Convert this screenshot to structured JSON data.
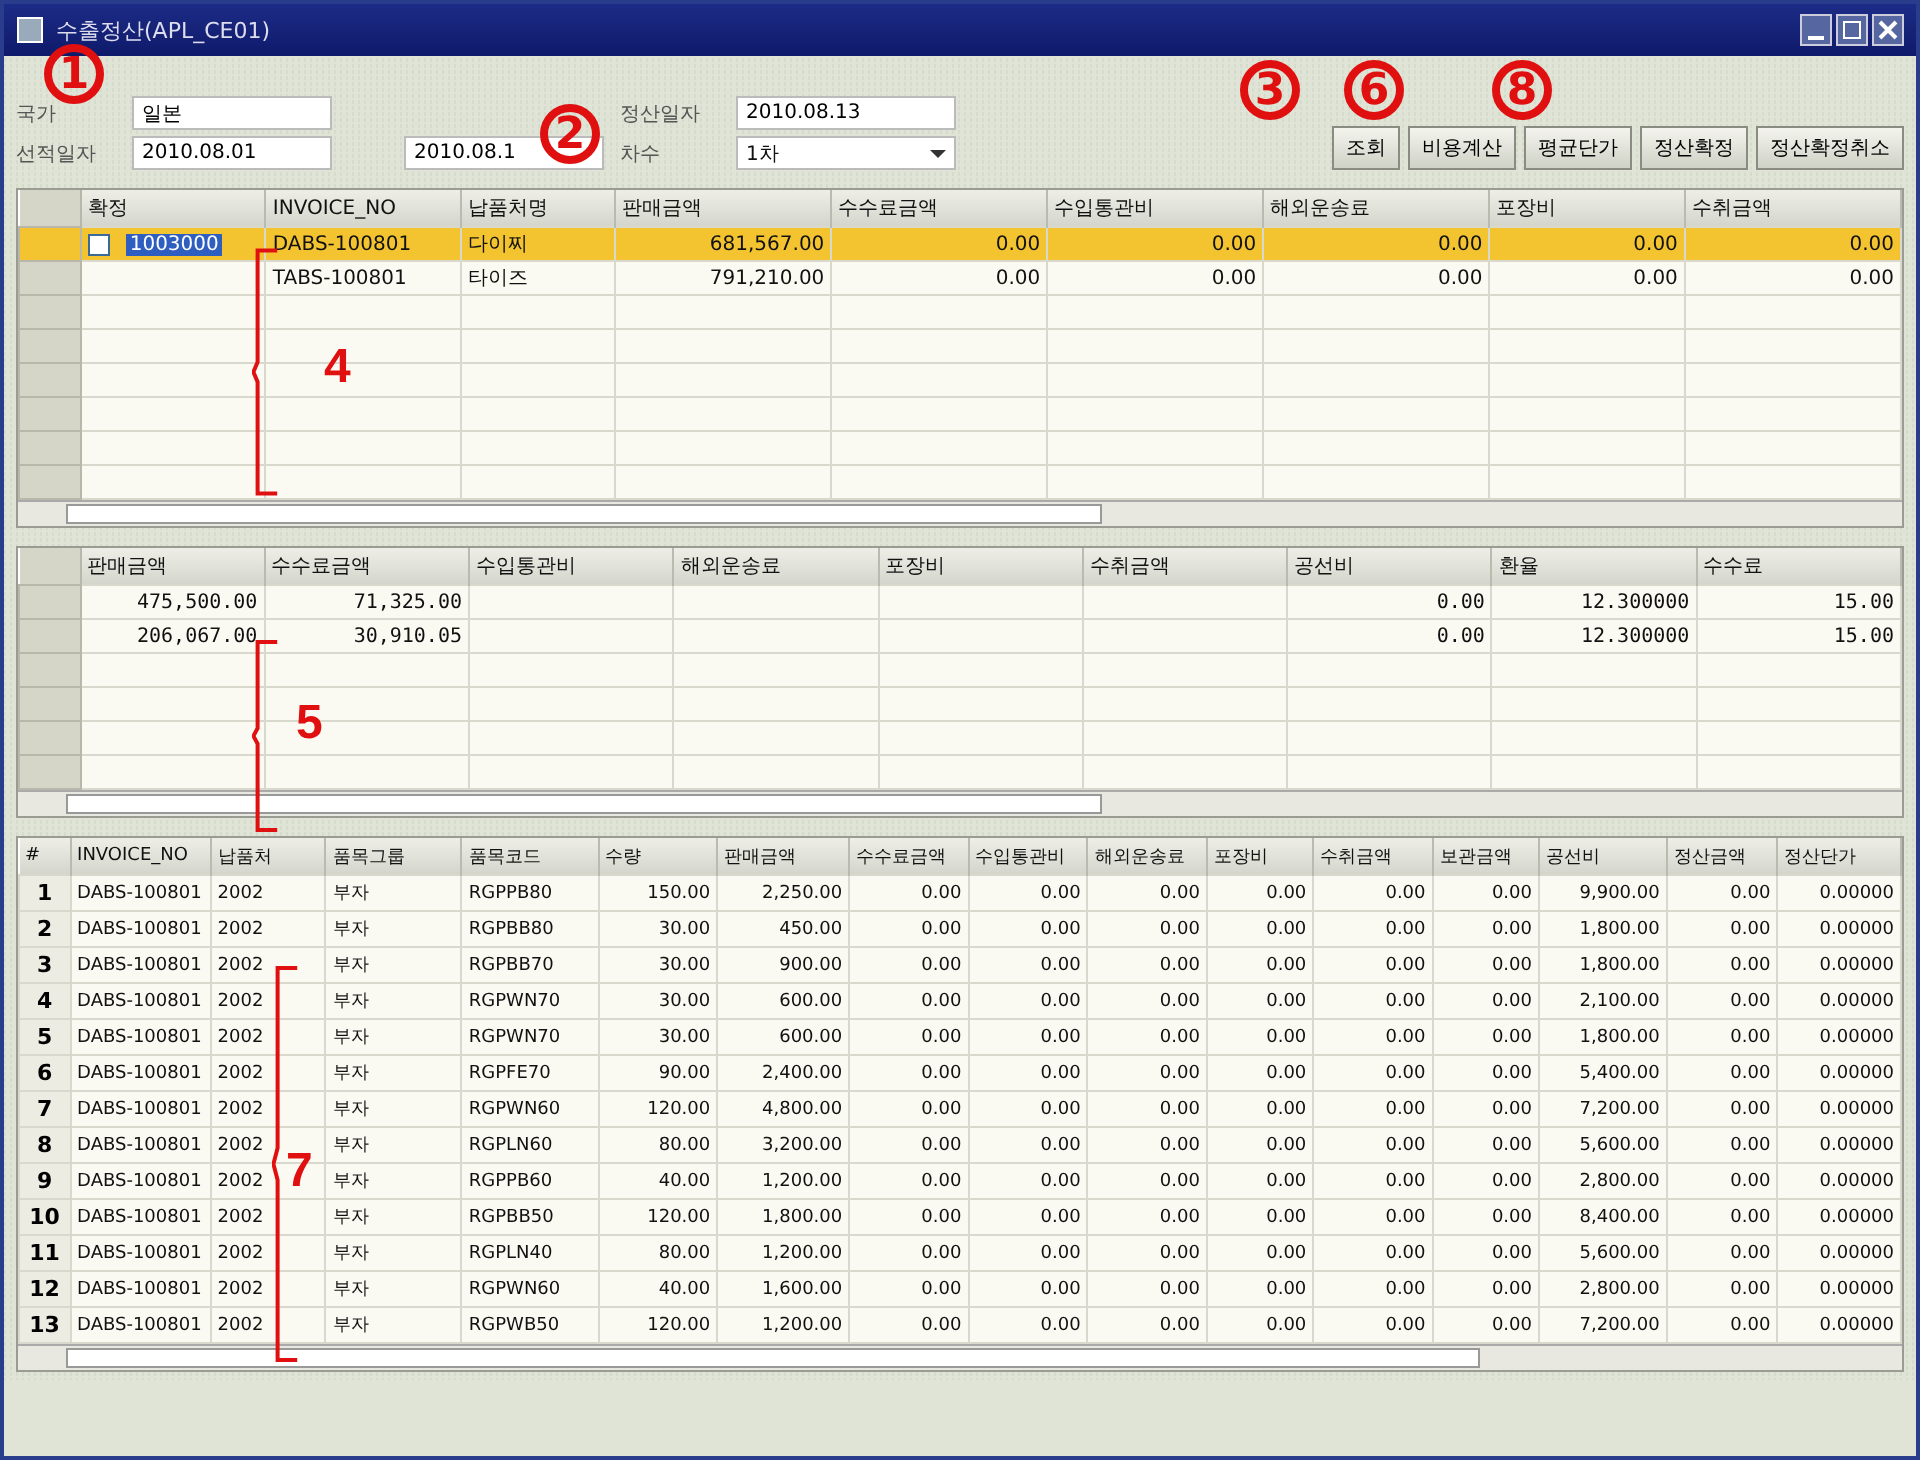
{
  "window": {
    "title": "수출정산(APL_CE01)"
  },
  "form": {
    "country_label": "국가",
    "country": "일본",
    "ship_date_label": "선적일자",
    "ship_from": "2010.08.01",
    "ship_to": "2010.08.1",
    "settle_date_label": "정산일자",
    "settle_date": "2010.08.13",
    "round_label": "차수",
    "round": "1차"
  },
  "buttons": [
    "조회",
    "비용계산",
    "평균단가",
    "정산확정",
    "정산확정취소"
  ],
  "grid_1": {
    "columns": [
      "확정",
      "INVOICE_NO",
      "납품처명",
      "판매금액",
      "수수료금액",
      "수입통관비",
      "해외운송료",
      "포장비",
      "수취금액"
    ],
    "rows": [
      {
        "selected": true,
        "checked": false,
        "cells": [
          "1003000",
          "DABS-100801",
          "다이찌",
          "681,567.00",
          "0.00",
          "0.00",
          "0.00",
          "0.00",
          "0.00"
        ]
      },
      {
        "selected": false,
        "cells": [
          "",
          "TABS-100801",
          "타이즈",
          "791,210.00",
          "0.00",
          "0.00",
          "0.00",
          "0.00",
          "0.00"
        ]
      }
    ]
  },
  "grid_2": {
    "columns": [
      "판매금액",
      "수수료금액",
      "수입통관비",
      "해외운송료",
      "포장비",
      "수취금액",
      "공선비",
      "환율",
      "수수료"
    ],
    "rows": [
      [
        "475,500.00",
        "71,325.00",
        "",
        "",
        "",
        "",
        "0.00",
        "12.300000",
        "15.00"
      ],
      [
        "206,067.00",
        "30,910.05",
        "",
        "",
        "",
        "",
        "0.00",
        "12.300000",
        "15.00"
      ]
    ]
  },
  "grid_3": {
    "columns": [
      "#",
      "INVOICE_NO",
      "납품처",
      "품목그룹",
      "품목코드",
      "수량",
      "판매금액",
      "수수료금액",
      "수입통관비",
      "해외운송료",
      "포장비",
      "수취금액",
      "보관금액",
      "공선비",
      "정산금액",
      "정산단가"
    ],
    "rows": [
      [
        "1",
        "DABS-100801",
        "2002",
        "부자",
        "RGPPB80",
        "150.00",
        "2,250.00",
        "0.00",
        "0.00",
        "0.00",
        "0.00",
        "0.00",
        "0.00",
        "9,900.00",
        "0.00",
        "0.00000"
      ],
      [
        "2",
        "DABS-100801",
        "2002",
        "부자",
        "RGPBB80",
        "30.00",
        "450.00",
        "0.00",
        "0.00",
        "0.00",
        "0.00",
        "0.00",
        "0.00",
        "1,800.00",
        "0.00",
        "0.00000"
      ],
      [
        "3",
        "DABS-100801",
        "2002",
        "부자",
        "RGPBB70",
        "30.00",
        "900.00",
        "0.00",
        "0.00",
        "0.00",
        "0.00",
        "0.00",
        "0.00",
        "1,800.00",
        "0.00",
        "0.00000"
      ],
      [
        "4",
        "DABS-100801",
        "2002",
        "부자",
        "RGPWN70",
        "30.00",
        "600.00",
        "0.00",
        "0.00",
        "0.00",
        "0.00",
        "0.00",
        "0.00",
        "2,100.00",
        "0.00",
        "0.00000"
      ],
      [
        "5",
        "DABS-100801",
        "2002",
        "부자",
        "RGPWN70",
        "30.00",
        "600.00",
        "0.00",
        "0.00",
        "0.00",
        "0.00",
        "0.00",
        "0.00",
        "1,800.00",
        "0.00",
        "0.00000"
      ],
      [
        "6",
        "DABS-100801",
        "2002",
        "부자",
        "RGPFE70",
        "90.00",
        "2,400.00",
        "0.00",
        "0.00",
        "0.00",
        "0.00",
        "0.00",
        "0.00",
        "5,400.00",
        "0.00",
        "0.00000"
      ],
      [
        "7",
        "DABS-100801",
        "2002",
        "부자",
        "RGPWN60",
        "120.00",
        "4,800.00",
        "0.00",
        "0.00",
        "0.00",
        "0.00",
        "0.00",
        "0.00",
        "7,200.00",
        "0.00",
        "0.00000"
      ],
      [
        "8",
        "DABS-100801",
        "2002",
        "부자",
        "RGPLN60",
        "80.00",
        "3,200.00",
        "0.00",
        "0.00",
        "0.00",
        "0.00",
        "0.00",
        "0.00",
        "5,600.00",
        "0.00",
        "0.00000"
      ],
      [
        "9",
        "DABS-100801",
        "2002",
        "부자",
        "RGPPB60",
        "40.00",
        "1,200.00",
        "0.00",
        "0.00",
        "0.00",
        "0.00",
        "0.00",
        "0.00",
        "2,800.00",
        "0.00",
        "0.00000"
      ],
      [
        "10",
        "DABS-100801",
        "2002",
        "부자",
        "RGPBB50",
        "120.00",
        "1,800.00",
        "0.00",
        "0.00",
        "0.00",
        "0.00",
        "0.00",
        "0.00",
        "8,400.00",
        "0.00",
        "0.00000"
      ],
      [
        "11",
        "DABS-100801",
        "2002",
        "부자",
        "RGPLN40",
        "80.00",
        "1,200.00",
        "0.00",
        "0.00",
        "0.00",
        "0.00",
        "0.00",
        "0.00",
        "5,600.00",
        "0.00",
        "0.00000"
      ],
      [
        "12",
        "DABS-100801",
        "2002",
        "부자",
        "RGPWN60",
        "40.00",
        "1,600.00",
        "0.00",
        "0.00",
        "0.00",
        "0.00",
        "0.00",
        "0.00",
        "2,800.00",
        "0.00",
        "0.00000"
      ],
      [
        "13",
        "DABS-100801",
        "2002",
        "부자",
        "RGPWB50",
        "120.00",
        "1,200.00",
        "0.00",
        "0.00",
        "0.00",
        "0.00",
        "0.00",
        "0.00",
        "7,200.00",
        "0.00",
        "0.00000"
      ]
    ]
  },
  "annotations": [
    {
      "kind": "circle",
      "label": "1"
    },
    {
      "kind": "circle",
      "label": "2"
    },
    {
      "kind": "circle",
      "label": "3"
    },
    {
      "kind": "circle",
      "label": "6"
    },
    {
      "kind": "circle",
      "label": "8"
    },
    {
      "kind": "brace",
      "label": "4"
    },
    {
      "kind": "brace",
      "label": "5"
    },
    {
      "kind": "brace",
      "label": "7"
    }
  ]
}
